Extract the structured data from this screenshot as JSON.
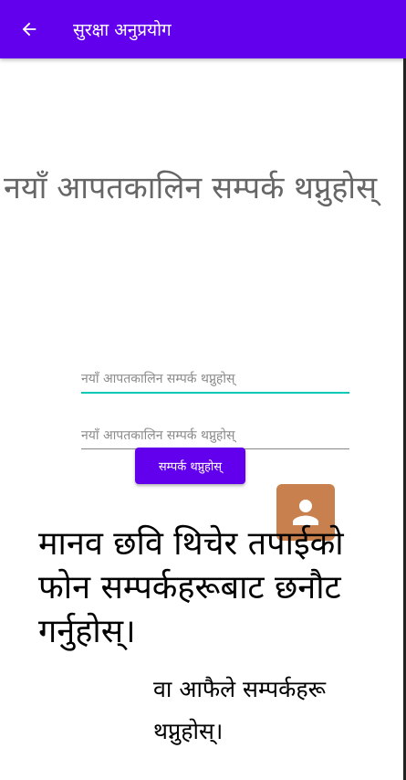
{
  "appbar": {
    "title": "सुरक्षा अनुप्रयोग",
    "back_icon": "arrow-left-icon",
    "color": "#6200ee"
  },
  "main": {
    "heading": "नयाँ आपतकालिन सम्पर्क थप्नुहोस्",
    "name_field": {
      "placeholder": "नयाँ आपतकालिन सम्पर्क थप्नुहोस्",
      "value": ""
    },
    "number_field": {
      "placeholder": "नयाँ आपतकालिन सम्पर्क थप्नुहोस्",
      "value": ""
    },
    "add_button_label": "सम्पर्क थप्नुहोस्",
    "contact_icon": "person-icon",
    "contact_tile_color": "#c8804e",
    "pick_instruction": "मानव छवि थिचेर तपाईको फोन सम्पर्कहरूबाट छनौट गर्नुहोस्।",
    "manual_instruction": "वा आफैले सम्पर्कहरू थप्नुहोस्।"
  }
}
